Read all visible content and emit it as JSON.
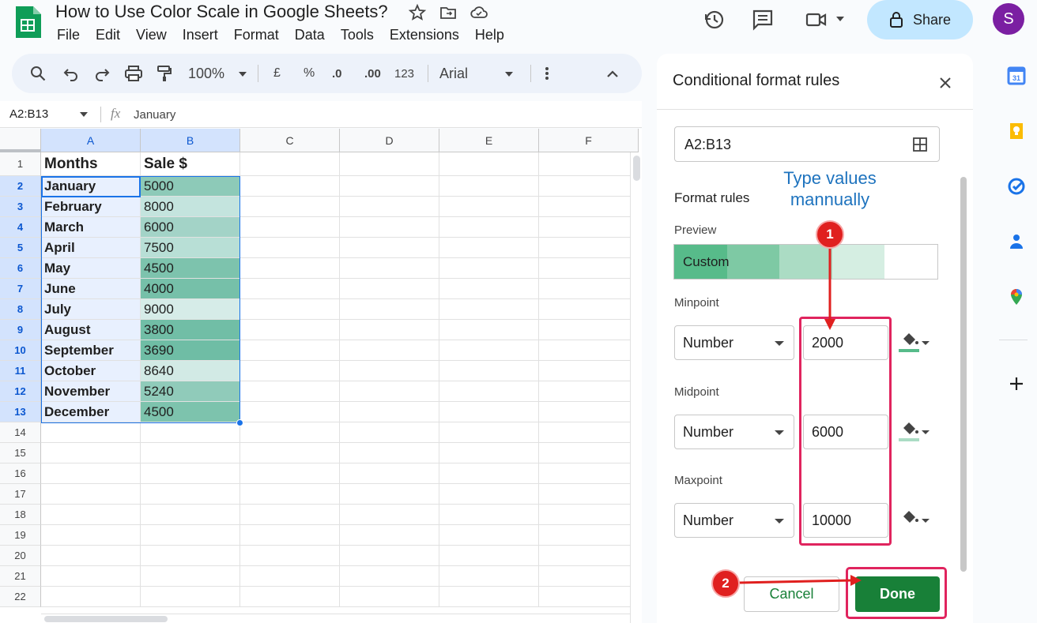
{
  "app": {
    "title": "How to Use Color Scale in Google Sheets?",
    "menu": [
      "File",
      "Edit",
      "View",
      "Insert",
      "Format",
      "Data",
      "Tools",
      "Extensions",
      "Help"
    ],
    "share_label": "Share",
    "avatar_initial": "S"
  },
  "toolbar": {
    "zoom": "100%",
    "currency": "£",
    "percent": "%",
    "dec_decrease": ".0",
    "dec_increase": ".00",
    "number_format": "123",
    "font": "Arial"
  },
  "formula_bar": {
    "name_box": "A2:B13",
    "fx": "fx",
    "value": "January"
  },
  "sheet": {
    "columns": [
      "A",
      "B",
      "C",
      "D",
      "E",
      "F"
    ],
    "row_numbers": [
      "1",
      "2",
      "3",
      "4",
      "5",
      "6",
      "7",
      "8",
      "9",
      "10",
      "11",
      "12",
      "13",
      "14",
      "15",
      "16",
      "17",
      "18",
      "19",
      "20",
      "21",
      "22"
    ],
    "header": {
      "a": "Months",
      "b": "Sale $"
    },
    "rows": [
      {
        "month": "January",
        "sale": "5000",
        "color": "#8dcab8"
      },
      {
        "month": "February",
        "sale": "8000",
        "color": "#c4e4de"
      },
      {
        "month": "March",
        "sale": "6000",
        "color": "#a3d3c7"
      },
      {
        "month": "April",
        "sale": "7500",
        "color": "#b8dfd6"
      },
      {
        "month": "May",
        "sale": "4500",
        "color": "#7dc3ad"
      },
      {
        "month": "June",
        "sale": "4000",
        "color": "#76c0a9"
      },
      {
        "month": "July",
        "sale": "9000",
        "color": "#d6ece8"
      },
      {
        "month": "August",
        "sale": "3800",
        "color": "#71bea6"
      },
      {
        "month": "September",
        "sale": "3690",
        "color": "#6fbda5"
      },
      {
        "month": "October",
        "sale": "8640",
        "color": "#d2eae5"
      },
      {
        "month": "November",
        "sale": "5240",
        "color": "#90cbba"
      },
      {
        "month": "December",
        "sale": "4500",
        "color": "#7dc3ad"
      }
    ]
  },
  "panel": {
    "title": "Conditional format rules",
    "range": "A2:B13",
    "format_rules_label": "Format rules",
    "preview_label": "Preview",
    "preview_text": "Custom",
    "minpoint": {
      "label": "Minpoint",
      "type": "Number",
      "value": "2000",
      "color": "#57bb8a"
    },
    "midpoint": {
      "label": "Midpoint",
      "type": "Number",
      "value": "6000",
      "color": "#abdcc4"
    },
    "maxpoint": {
      "label": "Maxpoint",
      "type": "Number",
      "value": "10000",
      "color": "#ffffff"
    },
    "cancel_label": "Cancel",
    "done_label": "Done"
  },
  "annotations": {
    "callout_text_line1": "Type values",
    "callout_text_line2": "mannually",
    "step1": "1",
    "step2": "2"
  },
  "colors": {
    "accent_green": "#188038",
    "annotation_red": "#e0245e",
    "annotation_blue": "#1e73be"
  }
}
